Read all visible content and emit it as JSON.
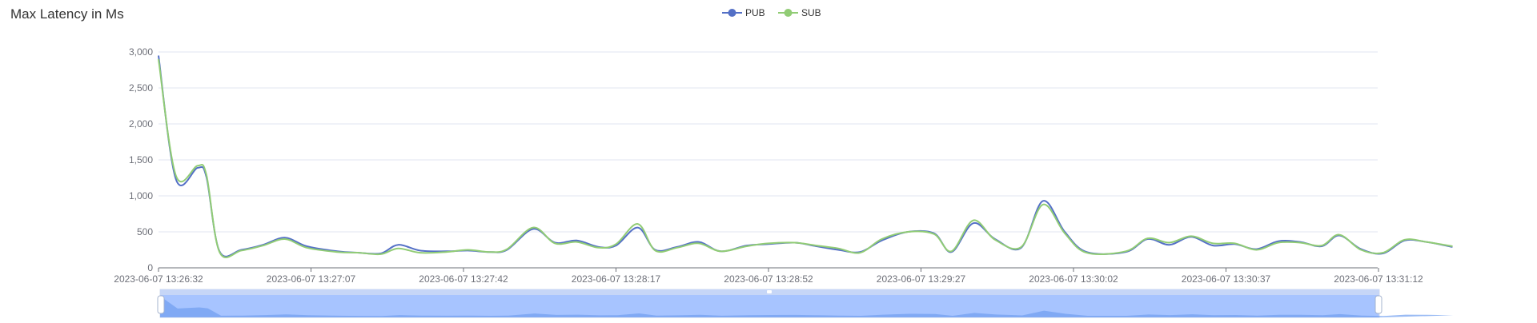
{
  "title": "Max Latency in Ms",
  "colors": {
    "pub": "#5470c6",
    "sub": "#91cc75",
    "grid": "#e0e6f1",
    "axis": "#6e7079"
  },
  "chart_data": {
    "type": "line",
    "title": "Max Latency in Ms",
    "xlabel": "",
    "ylabel": "",
    "ylim": [
      0,
      3000
    ],
    "yticks": [
      "0",
      "500",
      "1,000",
      "1,500",
      "2,000",
      "2,500",
      "3,000"
    ],
    "xticks": [
      "2023-06-07 13:26:32",
      "2023-06-07 13:27:07",
      "2023-06-07 13:27:42",
      "2023-06-07 13:28:17",
      "2023-06-07 13:28:52",
      "2023-06-07 13:29:27",
      "2023-06-07 13:30:02",
      "2023-06-07 13:30:37",
      "2023-06-07 13:31:12"
    ],
    "x_start": "2023-06-07 13:26:32",
    "x_end": "2023-06-07 13:31:12",
    "legend_position": "top-center",
    "grid": true,
    "smooth": true,
    "series": [
      {
        "name": "PUB",
        "points": [
          [
            "13:26:32",
            2950
          ],
          [
            "13:26:36",
            1230
          ],
          [
            "13:26:41",
            1390
          ],
          [
            "13:26:43",
            1260
          ],
          [
            "13:26:46",
            230
          ],
          [
            "13:26:51",
            250
          ],
          [
            "13:26:56",
            320
          ],
          [
            "13:27:01",
            420
          ],
          [
            "13:27:06",
            300
          ],
          [
            "13:27:13",
            230
          ],
          [
            "13:27:18",
            210
          ],
          [
            "13:27:23",
            200
          ],
          [
            "13:27:27",
            320
          ],
          [
            "13:27:32",
            240
          ],
          [
            "13:27:38",
            230
          ],
          [
            "13:27:43",
            240
          ],
          [
            "13:27:48",
            220
          ],
          [
            "13:27:52",
            250
          ],
          [
            "13:27:58",
            540
          ],
          [
            "13:28:03",
            350
          ],
          [
            "13:28:08",
            380
          ],
          [
            "13:28:13",
            290
          ],
          [
            "13:28:17",
            310
          ],
          [
            "13:28:22",
            560
          ],
          [
            "13:28:26",
            250
          ],
          [
            "13:28:31",
            290
          ],
          [
            "13:28:36",
            360
          ],
          [
            "13:28:41",
            230
          ],
          [
            "13:28:47",
            310
          ],
          [
            "13:28:52",
            330
          ],
          [
            "13:28:58",
            350
          ],
          [
            "13:29:03",
            300
          ],
          [
            "13:29:08",
            250
          ],
          [
            "13:29:13",
            220
          ],
          [
            "13:29:18",
            380
          ],
          [
            "13:29:24",
            500
          ],
          [
            "13:29:30",
            480
          ],
          [
            "13:29:34",
            220
          ],
          [
            "13:29:39",
            620
          ],
          [
            "13:29:44",
            400
          ],
          [
            "13:29:50",
            280
          ],
          [
            "13:29:55",
            930
          ],
          [
            "13:30:00",
            500
          ],
          [
            "13:30:05",
            220
          ],
          [
            "13:30:14",
            220
          ],
          [
            "13:30:19",
            400
          ],
          [
            "13:30:24",
            320
          ],
          [
            "13:30:29",
            430
          ],
          [
            "13:30:34",
            310
          ],
          [
            "13:30:39",
            330
          ],
          [
            "13:30:44",
            260
          ],
          [
            "13:30:49",
            370
          ],
          [
            "13:30:54",
            360
          ],
          [
            "13:30:59",
            300
          ],
          [
            "13:31:03",
            450
          ],
          [
            "13:31:08",
            260
          ],
          [
            "13:31:13",
            200
          ],
          [
            "13:31:18",
            380
          ],
          [
            "13:31:23",
            360
          ],
          [
            "13:31:29",
            290
          ]
        ]
      },
      {
        "name": "SUB",
        "points": [
          [
            "13:26:32",
            2900
          ],
          [
            "13:26:36",
            1280
          ],
          [
            "13:26:41",
            1420
          ],
          [
            "13:26:43",
            1290
          ],
          [
            "13:26:46",
            220
          ],
          [
            "13:26:51",
            240
          ],
          [
            "13:26:56",
            310
          ],
          [
            "13:27:01",
            400
          ],
          [
            "13:27:06",
            280
          ],
          [
            "13:27:13",
            220
          ],
          [
            "13:27:18",
            210
          ],
          [
            "13:27:23",
            190
          ],
          [
            "13:27:27",
            270
          ],
          [
            "13:27:32",
            210
          ],
          [
            "13:27:38",
            220
          ],
          [
            "13:27:43",
            250
          ],
          [
            "13:27:48",
            220
          ],
          [
            "13:27:52",
            260
          ],
          [
            "13:27:58",
            560
          ],
          [
            "13:28:03",
            340
          ],
          [
            "13:28:08",
            360
          ],
          [
            "13:28:13",
            280
          ],
          [
            "13:28:17",
            330
          ],
          [
            "13:28:22",
            610
          ],
          [
            "13:28:26",
            240
          ],
          [
            "13:28:31",
            280
          ],
          [
            "13:28:36",
            340
          ],
          [
            "13:28:41",
            230
          ],
          [
            "13:28:47",
            300
          ],
          [
            "13:28:52",
            340
          ],
          [
            "13:28:58",
            350
          ],
          [
            "13:29:03",
            310
          ],
          [
            "13:29:08",
            270
          ],
          [
            "13:29:13",
            210
          ],
          [
            "13:29:18",
            400
          ],
          [
            "13:29:24",
            500
          ],
          [
            "13:29:30",
            470
          ],
          [
            "13:29:34",
            230
          ],
          [
            "13:29:39",
            660
          ],
          [
            "13:29:44",
            390
          ],
          [
            "13:29:50",
            290
          ],
          [
            "13:29:55",
            880
          ],
          [
            "13:30:00",
            480
          ],
          [
            "13:30:05",
            210
          ],
          [
            "13:30:14",
            230
          ],
          [
            "13:30:19",
            410
          ],
          [
            "13:30:24",
            350
          ],
          [
            "13:30:29",
            440
          ],
          [
            "13:30:34",
            340
          ],
          [
            "13:30:39",
            340
          ],
          [
            "13:30:44",
            250
          ],
          [
            "13:30:49",
            350
          ],
          [
            "13:30:54",
            350
          ],
          [
            "13:30:59",
            310
          ],
          [
            "13:31:03",
            460
          ],
          [
            "13:31:08",
            250
          ],
          [
            "13:31:13",
            210
          ],
          [
            "13:31:18",
            390
          ],
          [
            "13:31:23",
            360
          ],
          [
            "13:31:29",
            300
          ]
        ]
      }
    ]
  }
}
